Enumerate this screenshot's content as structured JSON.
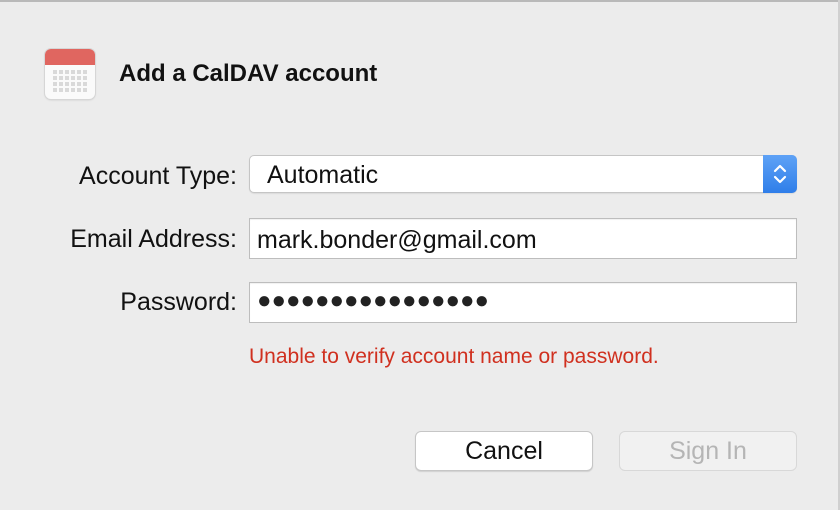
{
  "dialog": {
    "title": "Add a CalDAV account",
    "icon": "calendar-icon"
  },
  "form": {
    "account_type": {
      "label": "Account Type:",
      "value": "Automatic",
      "icon": "stepper-arrows-icon"
    },
    "email": {
      "label": "Email Address:",
      "value": "mark.bonder@gmail.com"
    },
    "password": {
      "label": "Password:",
      "masked_value": "●●●●●●●●●●●●●●●●"
    },
    "error": "Unable to verify account name or password."
  },
  "buttons": {
    "cancel": "Cancel",
    "sign_in": "Sign In"
  },
  "colors": {
    "window_bg": "#ececec",
    "error": "#d0301f",
    "accent": "#2f7ee9",
    "calendar_red": "#e06660"
  }
}
